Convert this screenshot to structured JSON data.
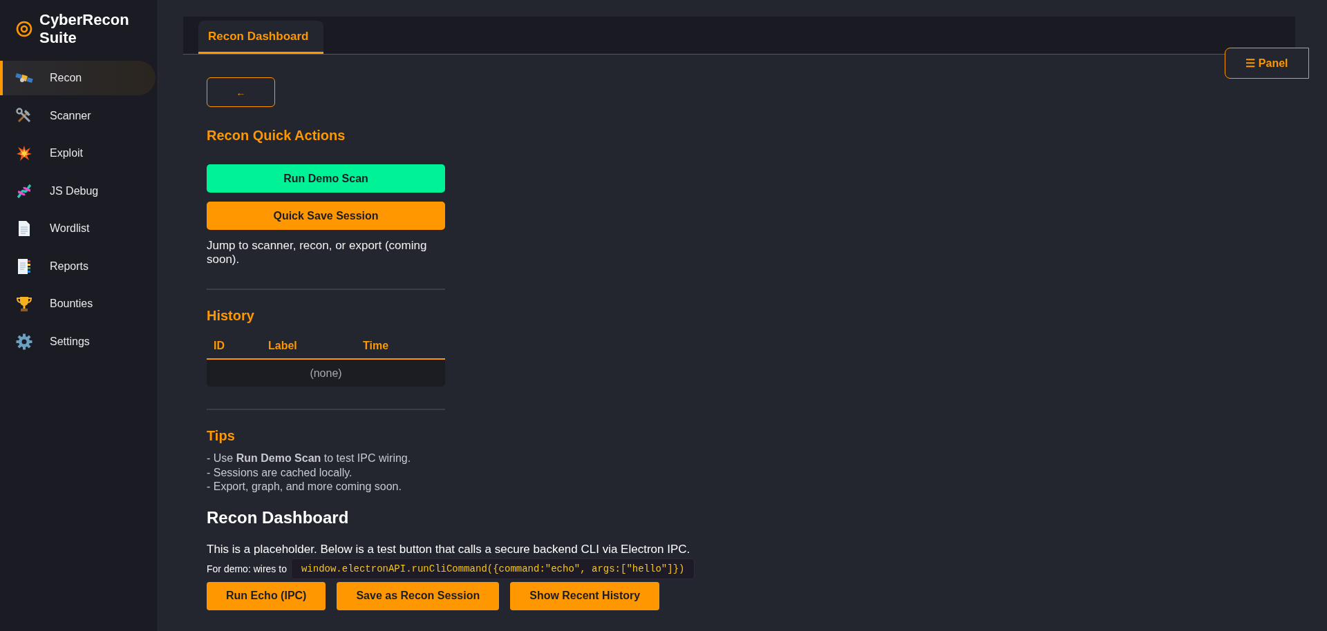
{
  "app": {
    "title": "CyberRecon Suite"
  },
  "sidebar": {
    "items": [
      {
        "label": "Recon",
        "kind": "satellite",
        "selected": true
      },
      {
        "label": "Scanner",
        "kind": "tools",
        "selected": false
      },
      {
        "label": "Exploit",
        "kind": "burst",
        "selected": false
      },
      {
        "label": "JS Debug",
        "kind": "dna",
        "selected": false
      },
      {
        "label": "Wordlist",
        "kind": "page",
        "selected": false
      },
      {
        "label": "Reports",
        "kind": "report",
        "selected": false
      },
      {
        "label": "Bounties",
        "kind": "trophy",
        "selected": false
      },
      {
        "label": "Settings",
        "kind": "gear",
        "selected": false
      }
    ]
  },
  "tabs": [
    {
      "label": "Recon Dashboard",
      "selected": true
    }
  ],
  "panel_button": {
    "icon": "☰",
    "label": "Panel"
  },
  "back_button": "←",
  "quick_actions": {
    "title": "Recon Quick Actions",
    "buttons": [
      {
        "label": "Run Demo Scan",
        "kind": "green"
      },
      {
        "label": "Quick Save Session",
        "kind": "orange"
      }
    ],
    "note": "Jump to scanner, recon, or export (coming soon)."
  },
  "history": {
    "title": "History",
    "columns": [
      "ID",
      "Label",
      "Time"
    ],
    "empty": "(none)"
  },
  "tips": {
    "title": "Tips",
    "lines": [
      "- Use **Run Demo Scan** to test IPC wiring.",
      "- Sessions are cached locally.",
      "- Export, graph, and more coming soon."
    ]
  },
  "dashboard": {
    "title": "Recon Dashboard",
    "text": "This is a placeholder. Below is a test button that calls a secure backend CLI via Electron IPC.",
    "demo_label": "For demo: wires to",
    "code": "window.electronAPI.runCliCommand({command:\"echo\", args:[\"hello\"]})",
    "buttons": [
      "Run Echo (IPC)",
      "Save as Recon Session",
      "Show Recent History"
    ]
  }
}
